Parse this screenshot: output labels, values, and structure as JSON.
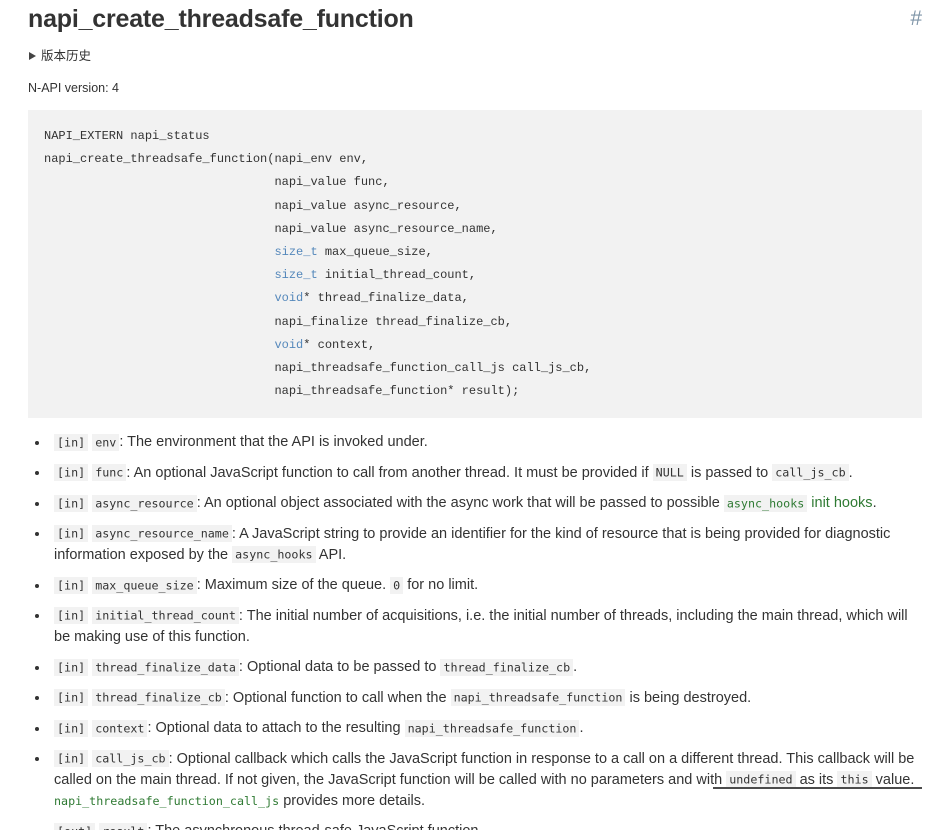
{
  "header": {
    "title": "napi_create_threadsafe_function",
    "anchor_symbol": "#"
  },
  "history": {
    "summary_label": "版本历史",
    "expanded": false
  },
  "napi_version_line": "N-API version: 4",
  "code_block": {
    "language": "c",
    "lines": [
      "NAPI_EXTERN napi_status",
      "napi_create_threadsafe_function(napi_env env,",
      "                                napi_value func,",
      "                                napi_value async_resource,",
      "                                napi_value async_resource_name,",
      "                                size_t max_queue_size,",
      "                                size_t initial_thread_count,",
      "                                void* thread_finalize_data,",
      "                                napi_finalize thread_finalize_cb,",
      "                                void* context,",
      "                                napi_threadsafe_function_call_js call_js_cb,",
      "                                napi_threadsafe_function* result);"
    ],
    "keywords": [
      "size_t",
      "void"
    ]
  },
  "parameters": [
    {
      "direction": "[in]",
      "name": "env",
      "description": "The environment that the API is invoked under."
    },
    {
      "direction": "[in]",
      "name": "func",
      "description_parts": [
        {
          "type": "text",
          "text": "An optional JavaScript function to call from another thread. It must be provided if "
        },
        {
          "type": "code",
          "text": "NULL"
        },
        {
          "type": "text",
          "text": " is passed to "
        },
        {
          "type": "code",
          "text": "call_js_cb"
        },
        {
          "type": "text",
          "text": "."
        }
      ]
    },
    {
      "direction": "[in]",
      "name": "async_resource",
      "description_parts": [
        {
          "type": "text",
          "text": "An optional object associated with the async work that will be passed to possible "
        },
        {
          "type": "link-code",
          "text": "async_hooks"
        },
        {
          "type": "link-text",
          "text": " init hooks"
        },
        {
          "type": "text",
          "text": "."
        }
      ]
    },
    {
      "direction": "[in]",
      "name": "async_resource_name",
      "description_parts": [
        {
          "type": "text",
          "text": "A JavaScript string to provide an identifier for the kind of resource that is being provided for diagnostic information exposed by the "
        },
        {
          "type": "code",
          "text": "async_hooks"
        },
        {
          "type": "text",
          "text": " API."
        }
      ]
    },
    {
      "direction": "[in]",
      "name": "max_queue_size",
      "description_parts": [
        {
          "type": "text",
          "text": "Maximum size of the queue. "
        },
        {
          "type": "code",
          "text": "0"
        },
        {
          "type": "text",
          "text": " for no limit."
        }
      ]
    },
    {
      "direction": "[in]",
      "name": "initial_thread_count",
      "description": "The initial number of acquisitions, i.e. the initial number of threads, including the main thread, which will be making use of this function."
    },
    {
      "direction": "[in]",
      "name": "thread_finalize_data",
      "description_parts": [
        {
          "type": "text",
          "text": "Optional data to be passed to "
        },
        {
          "type": "code",
          "text": "thread_finalize_cb"
        },
        {
          "type": "text",
          "text": "."
        }
      ]
    },
    {
      "direction": "[in]",
      "name": "thread_finalize_cb",
      "description_parts": [
        {
          "type": "text",
          "text": "Optional function to call when the "
        },
        {
          "type": "code",
          "text": "napi_threadsafe_function"
        },
        {
          "type": "text",
          "text": " is being destroyed."
        }
      ]
    },
    {
      "direction": "[in]",
      "name": "context",
      "description_parts": [
        {
          "type": "text",
          "text": "Optional data to attach to the resulting "
        },
        {
          "type": "code",
          "text": "napi_threadsafe_function"
        },
        {
          "type": "text",
          "text": "."
        }
      ]
    },
    {
      "direction": "[in]",
      "name": "call_js_cb",
      "description_parts": [
        {
          "type": "text",
          "text": "Optional callback which calls the JavaScript function in response to a call on a different thread. This callback will be called on the main thread. If not given, the JavaScript function will be called with no parameters and with "
        },
        {
          "type": "code",
          "text": "undefined"
        },
        {
          "type": "text",
          "text": " as its "
        },
        {
          "type": "code",
          "text": "this"
        },
        {
          "type": "text",
          "text": " value. "
        },
        {
          "type": "link-code-plain",
          "text": "napi_threadsafe_function_call_js"
        },
        {
          "type": "text",
          "text": " provides more details."
        }
      ]
    },
    {
      "direction": "[out]",
      "name": "result",
      "description": "The asynchronous thread-safe JavaScript function."
    }
  ],
  "colors": {
    "text": "#333333",
    "link_green": "#2f7a33",
    "keyword_blue": "#5588bb",
    "code_bg": "#f2f2f2",
    "anchor": "#7f95a8"
  }
}
